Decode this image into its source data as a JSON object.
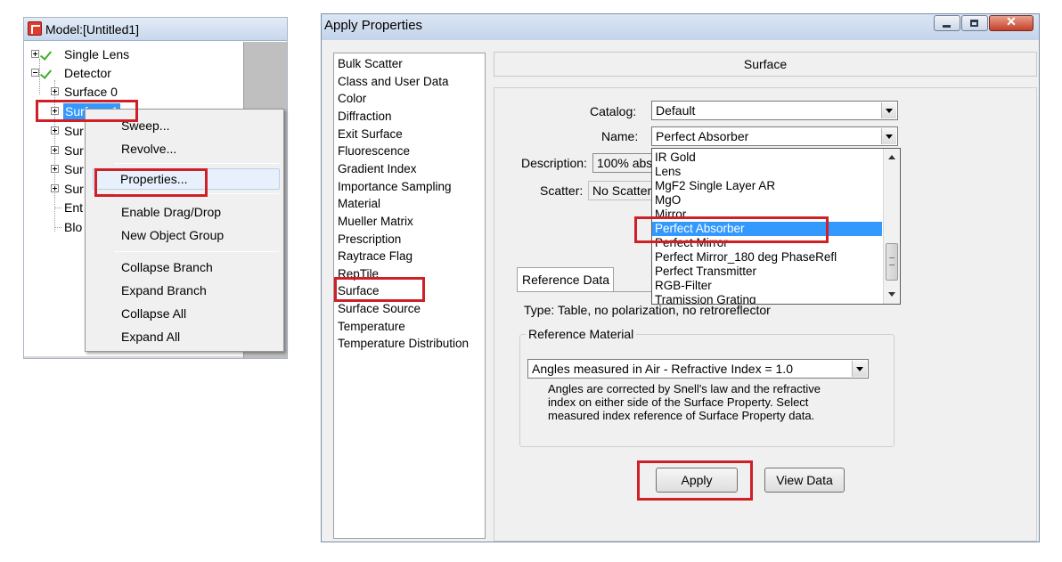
{
  "tree": {
    "title": "Model:[Untitled1]",
    "nodes": [
      {
        "label": "Single Lens"
      },
      {
        "label": "Detector"
      },
      {
        "label": "Surface 0"
      },
      {
        "label": "Surface 1"
      },
      {
        "label": "Sur"
      },
      {
        "label": "Sur"
      },
      {
        "label": "Sur"
      },
      {
        "label": "Sur"
      },
      {
        "label": "Ent"
      },
      {
        "label": "Blo"
      }
    ]
  },
  "context_menu": {
    "items": [
      "Sweep...",
      "Revolve...",
      "Properties...",
      "Enable Drag/Drop",
      "New Object Group",
      "Collapse Branch",
      "Expand Branch",
      "Collapse All",
      "Expand All"
    ]
  },
  "dialog": {
    "title": "Apply Properties",
    "property_list": [
      "Bulk Scatter",
      "Class and User Data",
      "Color",
      "Diffraction",
      "Exit Surface",
      "Fluorescence",
      "Gradient Index",
      "Importance Sampling",
      "Material",
      "Mueller Matrix",
      "Prescription",
      "Raytrace Flag",
      "RepTile",
      "Surface",
      "Surface Source",
      "Temperature",
      "Temperature Distribution"
    ],
    "selected_property": "Surface",
    "header": "Surface",
    "catalog_label": "Catalog:",
    "catalog_value": "Default",
    "name_label": "Name:",
    "name_value": "Perfect Absorber",
    "description_label": "Description:",
    "description_value": "100% abs",
    "scatter_label": "Scatter:",
    "scatter_value": "No Scatter",
    "dropdown_items": [
      "IR Gold",
      "Lens",
      "MgF2 Single Layer AR",
      "MgO",
      "Mirror",
      "Perfect Absorber",
      "Perfect Mirror",
      "Perfect Mirror_180 deg PhaseRefl",
      "Perfect Transmitter",
      "RGB-Filter",
      "Tramission Grating"
    ],
    "dropdown_selected": "Perfect Absorber",
    "reference_tab": "Reference Data",
    "reference_type": "Type: Table, no polarization, no retroreflector",
    "reference_material_label": "Reference Material",
    "reference_material_value": "Angles measured in Air - Refractive Index = 1.0",
    "reference_description": "Angles are corrected by Snell's law and the refractive index on either side of the Surface Property.  Select measured index reference of Surface Property data.",
    "apply_button": "Apply",
    "view_data_button": "View Data"
  },
  "colors": {
    "annotation_red": "#cf1f27",
    "selection_blue": "#3399ff",
    "check_green": "#3fae29"
  }
}
